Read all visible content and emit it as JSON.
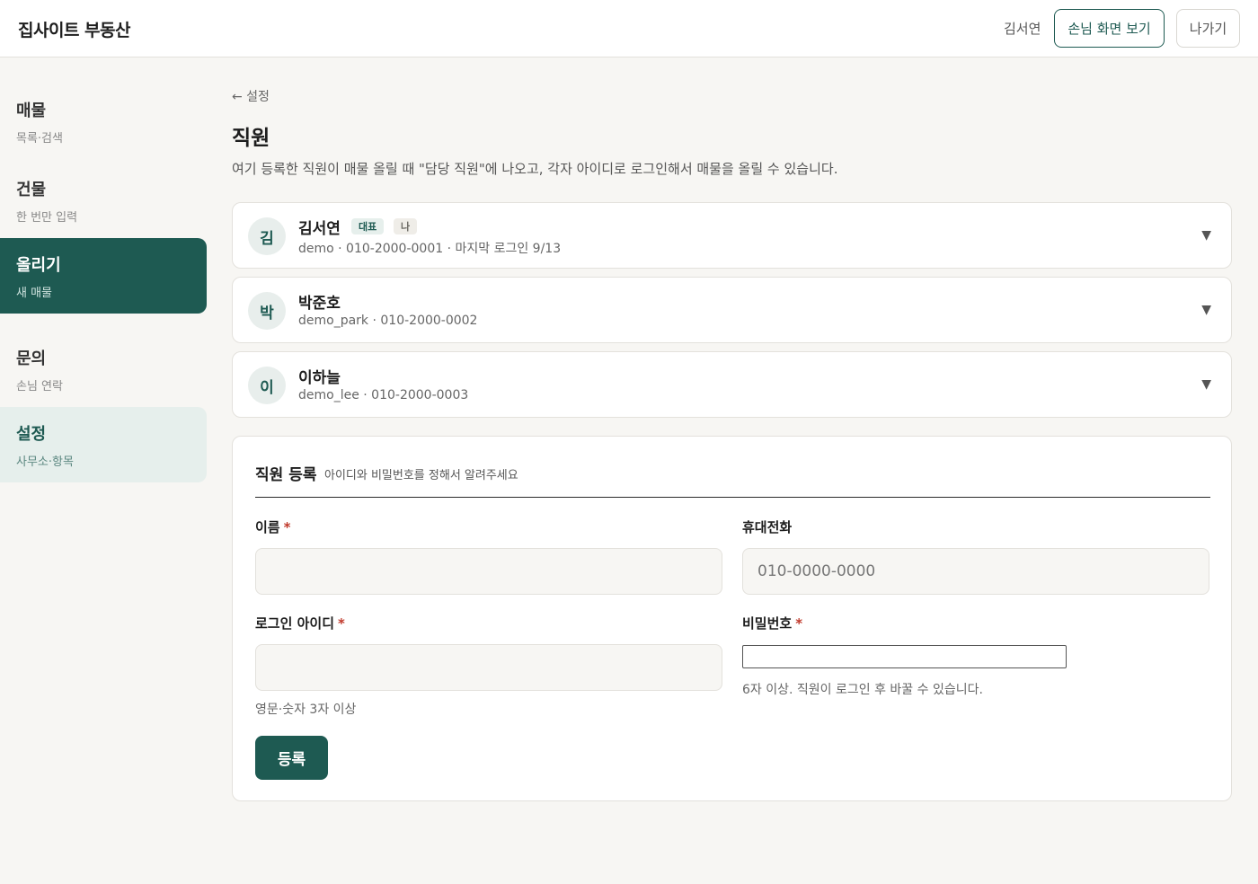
{
  "header": {
    "brand": "집사이트 부동산",
    "user": "김서연",
    "guest_view_button": "손님 화면 보기",
    "exit_button": "나가기"
  },
  "sidebar": {
    "items": [
      {
        "title": "매물",
        "subtitle": "목록·검색"
      },
      {
        "title": "건물",
        "subtitle": "한 번만 입력"
      },
      {
        "title": "올리기",
        "subtitle": "새 매물"
      },
      {
        "title": "문의",
        "subtitle": "손님 연락"
      },
      {
        "title": "설정",
        "subtitle": "사무소·항목"
      }
    ]
  },
  "main": {
    "back_link": "← 설정",
    "title": "직원",
    "description": "여기 등록한 직원이 매물 올릴 때 \"담당 직원\"에 나오고, 각자 아이디로 로그인해서 매물을 올릴 수 있습니다.",
    "staff": [
      {
        "initial": "김",
        "name": "김서연",
        "badges": [
          "대표",
          "나"
        ],
        "meta": "demo · 010-2000-0001 · 마지막 로그인 9/13"
      },
      {
        "initial": "박",
        "name": "박준호",
        "badges": [],
        "meta": "demo_park · 010-2000-0002"
      },
      {
        "initial": "이",
        "name": "이하늘",
        "badges": [],
        "meta": "demo_lee · 010-2000-0003"
      }
    ],
    "expand_icon": "▼"
  },
  "form": {
    "title": "직원 등록",
    "subtitle": "아이디와 비밀번호를 정해서 알려주세요",
    "name_label": "이름",
    "phone_label": "휴대전화",
    "phone_placeholder": "010-0000-0000",
    "login_id_label": "로그인 아이디",
    "login_id_hint": "영문·숫자 3자 이상",
    "password_label": "비밀번호",
    "password_hint": "6자 이상. 직원이 로그인 후 바꿀 수 있습니다.",
    "required_mark": "*",
    "submit_button": "등록"
  }
}
